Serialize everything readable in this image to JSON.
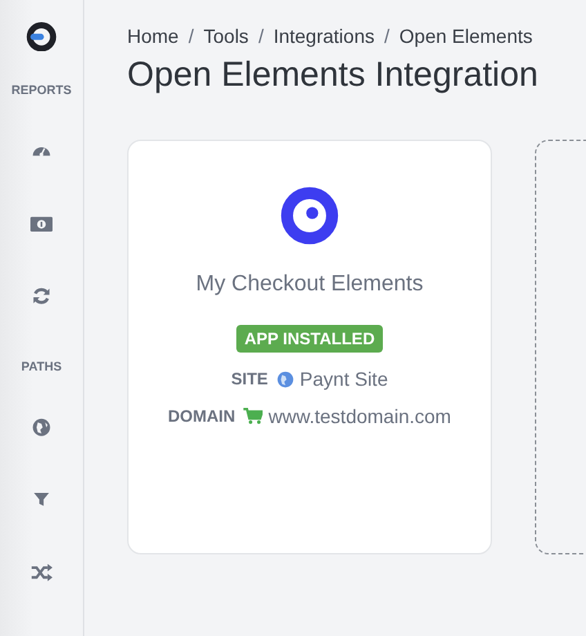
{
  "sidebar": {
    "sections": [
      {
        "label": "REPORTS",
        "items": [
          {
            "kind": "gauge"
          },
          {
            "kind": "money"
          },
          {
            "kind": "refresh"
          }
        ]
      },
      {
        "label": "PATHS",
        "items": [
          {
            "kind": "globe"
          },
          {
            "kind": "filter"
          },
          {
            "kind": "shuffle"
          }
        ]
      }
    ]
  },
  "breadcrumb": [
    {
      "kind": "link",
      "label": "Home"
    },
    {
      "kind": "separator",
      "label": "/"
    },
    {
      "kind": "link",
      "label": "Tools"
    },
    {
      "kind": "separator",
      "label": "/"
    },
    {
      "kind": "link",
      "label": "Integrations"
    },
    {
      "kind": "separator",
      "label": "/"
    },
    {
      "kind": "current",
      "label": "Open Elements"
    }
  ],
  "page_title": "Open Elements Integration",
  "cards": [
    {
      "kind": "app",
      "name": "My Checkout Elements",
      "status": "APP INSTALLED",
      "fields": [
        {
          "kind": "site",
          "label": "SITE",
          "value": "Paynt Site"
        },
        {
          "kind": "domain",
          "label": "DOMAIN",
          "value": "www.testdomain.com"
        }
      ]
    },
    {
      "kind": "placeholder"
    }
  ]
}
